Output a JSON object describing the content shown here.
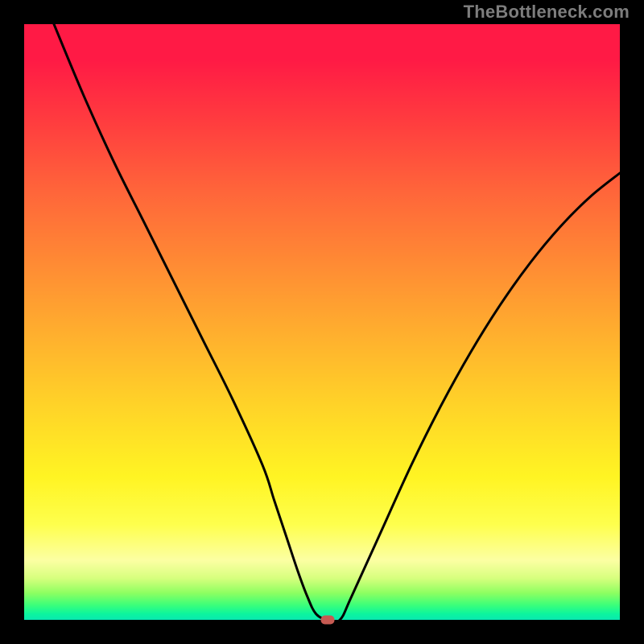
{
  "watermark": "TheBottleneck.com",
  "chart_data": {
    "type": "line",
    "title": "",
    "xlabel": "",
    "ylabel": "",
    "xlim": [
      0,
      100
    ],
    "ylim": [
      0,
      100
    ],
    "series": [
      {
        "name": "bottleneck-curve",
        "x": [
          5,
          10,
          15,
          20,
          25,
          30,
          35,
          40,
          42,
          44,
          46,
          47.5,
          49,
          51,
          53,
          55,
          60,
          65,
          70,
          75,
          80,
          85,
          90,
          95,
          100
        ],
        "values": [
          100,
          88,
          77,
          67,
          57,
          47,
          37,
          26,
          20,
          14,
          8,
          4,
          1,
          0,
          0,
          4,
          15,
          26,
          36,
          45,
          53,
          60,
          66,
          71,
          75
        ]
      }
    ],
    "marker": {
      "x": 51,
      "y": 0,
      "name": "min-point"
    },
    "background_gradient": {
      "stops": [
        {
          "offset": 0,
          "color": "#ff1a45"
        },
        {
          "offset": 40,
          "color": "#ff8a34"
        },
        {
          "offset": 76,
          "color": "#fff423"
        },
        {
          "offset": 93,
          "color": "#d7ff7e"
        },
        {
          "offset": 100,
          "color": "#09e7b1"
        }
      ]
    }
  }
}
